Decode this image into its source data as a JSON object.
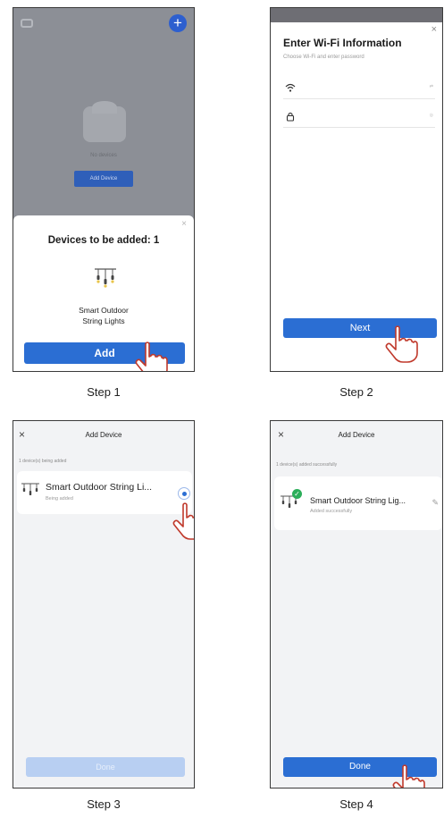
{
  "step1": {
    "caption": "Step 1",
    "background": {
      "no_devices": "No devices",
      "add_device_button": "Add Device"
    },
    "sheet": {
      "close": "×",
      "title": "Devices to be added: 1",
      "device_name_line1": "Smart Outdoor",
      "device_name_line2": "String Lights",
      "add_button": "Add"
    }
  },
  "step2": {
    "caption": "Step 2",
    "close": "×",
    "title": "Enter Wi-Fi Information",
    "subtitle": "Choose Wi-Fi and enter password",
    "next_button": "Next"
  },
  "step3": {
    "caption": "Step 3",
    "close": "×",
    "header_title": "Add Device",
    "status": "1 device(s) being added",
    "device": {
      "name": "Smart Outdoor String Li...",
      "state": "Being added"
    },
    "bottom_button": "Done"
  },
  "step4": {
    "caption": "Step 4",
    "close": "×",
    "header_title": "Add Device",
    "status": "1 device(s) added successfully",
    "device": {
      "name": "Smart Outdoor String Lig...",
      "state": "Added successfully"
    },
    "done_button": "Done"
  },
  "colors": {
    "primary": "#2b6ed3",
    "success": "#2cae5a",
    "overlay": "#8c8f96"
  }
}
